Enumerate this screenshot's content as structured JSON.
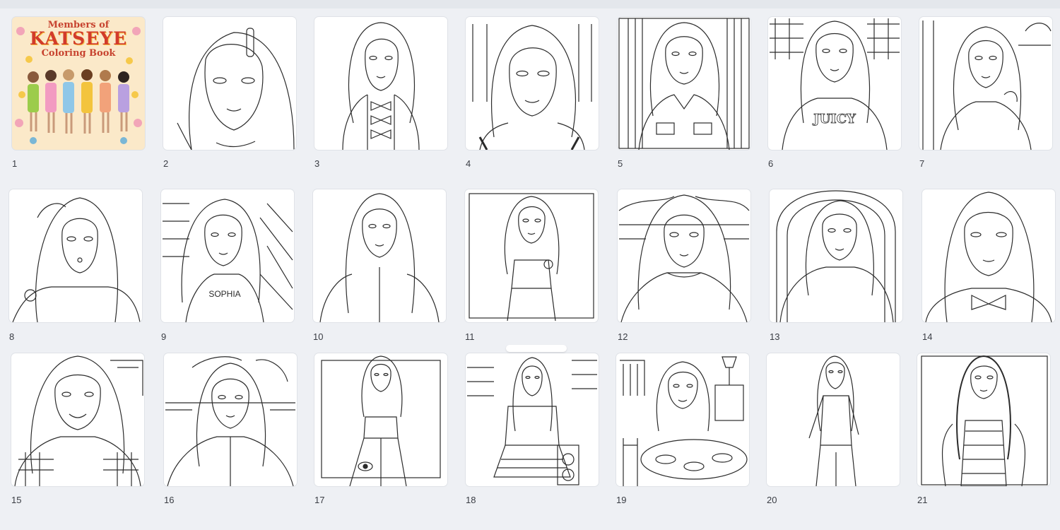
{
  "cover": {
    "line1": "Members of",
    "line2": "KATSEYE",
    "line3": "Coloring Book"
  },
  "pages": [
    {
      "number": "1"
    },
    {
      "number": "2"
    },
    {
      "number": "3"
    },
    {
      "number": "4"
    },
    {
      "number": "5"
    },
    {
      "number": "6"
    },
    {
      "number": "7"
    },
    {
      "number": "8"
    },
    {
      "number": "9"
    },
    {
      "number": "10"
    },
    {
      "number": "11"
    },
    {
      "number": "12"
    },
    {
      "number": "13"
    },
    {
      "number": "14"
    },
    {
      "number": "15"
    },
    {
      "number": "16"
    },
    {
      "number": "17"
    },
    {
      "number": "18"
    },
    {
      "number": "19"
    },
    {
      "number": "20"
    },
    {
      "number": "21"
    }
  ],
  "page_texts": {
    "p6_shirt": "JUICY",
    "p9_shirt": "SOPHIA"
  },
  "colors": {
    "background": "#eef0f4",
    "card": "#ffffff",
    "line_art": "#2b2b2b",
    "cover_bg": "#fbe9c9",
    "cover_title": "#d23b2b"
  }
}
